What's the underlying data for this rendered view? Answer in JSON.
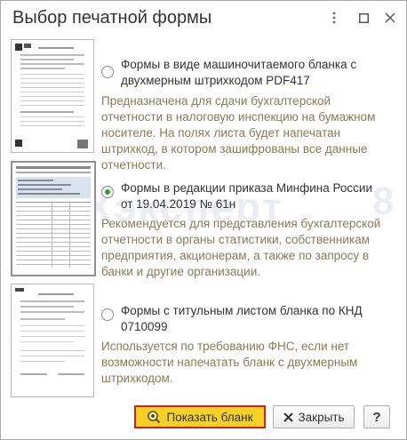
{
  "window": {
    "title": "Выбор печатной формы",
    "more_icon": "more-vertical-icon",
    "maximize_icon": "maximize-icon",
    "close_icon": "close-icon"
  },
  "options": [
    {
      "title": "Формы в виде машиночитаемого бланка с двухмерным штрихкодом PDF417",
      "description": "Предназначена для сдачи бухгалтерской отчетности в налоговую инспекцию на бумажном носителе. На полях листа будет напечатан штрихкод, в котором зашифрованы все данные отчетности.",
      "selected": false
    },
    {
      "title": "Формы в редакции приказа Минфина России от 19.04.2019 № 61н",
      "description": "Рекомендуется для представления бухгалтерской отчетности в органы статистики, собственникам предприятия, акционерам, а также по запросу в банки и другие организации.",
      "selected": true
    },
    {
      "title": "Формы с титульным листом бланка по КНД 0710099",
      "description": "Используется по требованию ФНС, если нет возможности напечатать бланк с двухмерным штрихкодом.",
      "selected": false
    }
  ],
  "watermark": {
    "text": "БУХэксперт",
    "number": "8",
    "sub": "У В"
  },
  "buttons": {
    "show_form": "Показать бланк",
    "show_form_icon": "preview-icon",
    "close": "Закрыть",
    "close_icon": "close-x-icon",
    "help": "?"
  },
  "colors": {
    "accent_button": "#f5d128",
    "highlight_border": "#d51e1e",
    "radio_selected": "#3a9a3a",
    "description_text": "#8a7a55"
  }
}
